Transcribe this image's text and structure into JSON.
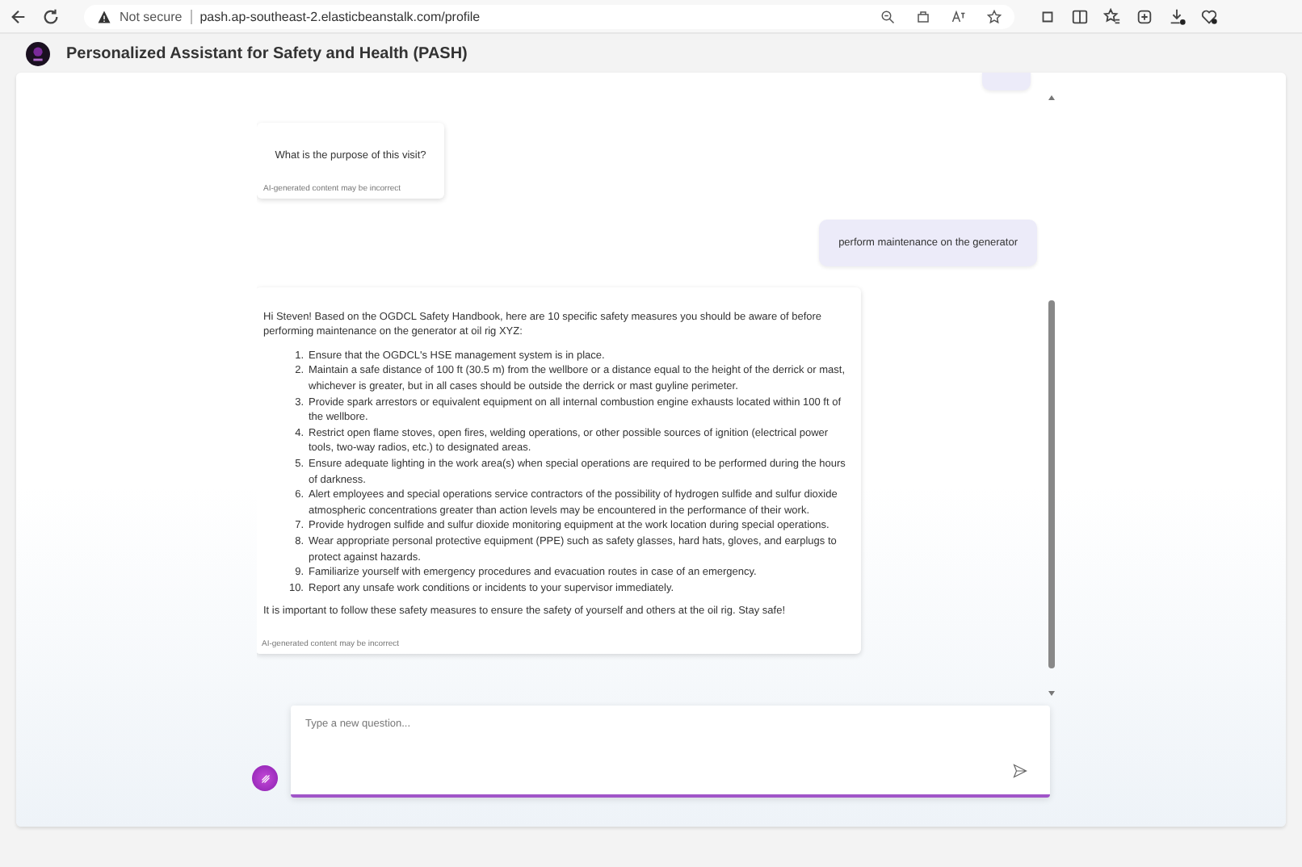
{
  "browser": {
    "security_label": "Not secure",
    "url": "pash.ap-southeast-2.elasticbeanstalk.com/profile"
  },
  "app": {
    "title": "Personalized Assistant for Safety and Health (PASH)"
  },
  "messages": [
    {
      "kind": "user_partial"
    },
    {
      "kind": "assistant",
      "text": "What is the purpose of this visit?",
      "disclaimer": "AI-generated content may be incorrect"
    },
    {
      "kind": "user",
      "text": "perform maintenance on the generator"
    },
    {
      "kind": "assistant_list",
      "intro": "Hi Steven! Based on the OGDCL Safety Handbook, here are 10 specific safety measures you should be aware of before performing maintenance on the generator at oil rig XYZ:",
      "items": [
        {
          "number": "1.",
          "text": "Ensure that the OGDCL's HSE management system is in place."
        },
        {
          "number": "2.",
          "text": "Maintain a safe distance of 100 ft (30.5 m) from the wellbore or a distance equal to the height of the derrick or mast, whichever is greater, but in all cases should be outside the derrick or mast guyline perimeter."
        },
        {
          "number": "3.",
          "text": "Provide spark arrestors or equivalent equipment on all internal combustion engine exhausts located within 100 ft of the wellbore."
        },
        {
          "number": "4.",
          "text": "Restrict open flame stoves, open fires, welding operations, or other possible sources of ignition (electrical power tools, two-way radios, etc.) to designated areas."
        },
        {
          "number": "5.",
          "text": "Ensure adequate lighting in the work area(s) when special operations are required to be performed during the hours of darkness."
        },
        {
          "number": "6.",
          "text": "Alert employees and special operations service contractors of the possibility of hydrogen sulfide and sulfur dioxide atmospheric concentrations greater than action levels may be encountered in the performance of their work."
        },
        {
          "number": "7.",
          "text": "Provide hydrogen sulfide and sulfur dioxide monitoring equipment at the work location during special operations."
        },
        {
          "number": "8.",
          "text": "Wear appropriate personal protective equipment (PPE) such as safety glasses, hard hats, gloves, and earplugs to protect against hazards."
        },
        {
          "number": "9.",
          "text": "Familiarize yourself with emergency procedures and evacuation routes in case of an emergency."
        },
        {
          "number": "10.",
          "text": "Report any unsafe work conditions or incidents to your supervisor immediately."
        }
      ],
      "outro": "It is important to follow these safety measures to ensure the safety of yourself and others at the oil rig. Stay safe!",
      "disclaimer": "AI-generated content may be incorrect"
    }
  ],
  "composer": {
    "placeholder": "Type a new question..."
  }
}
